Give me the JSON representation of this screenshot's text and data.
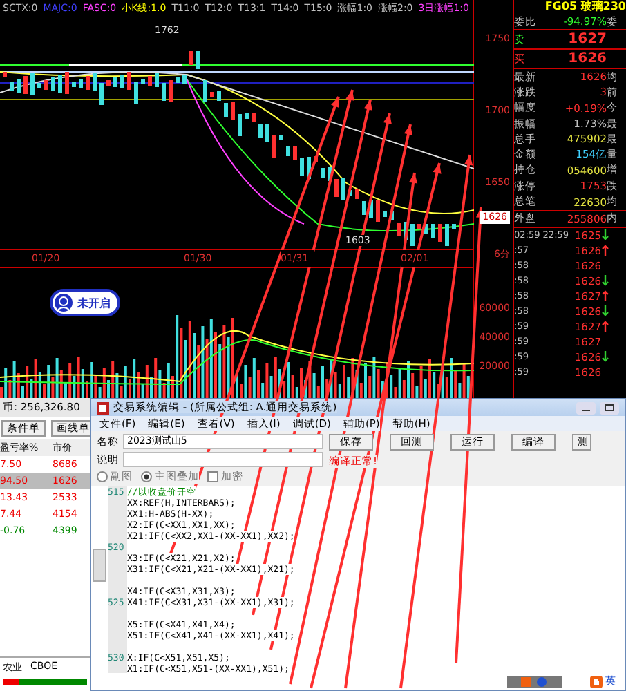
{
  "indicator_bar": [
    {
      "label": "SCTX:0",
      "color": "#c0c0c0"
    },
    {
      "label": "MAJC:0",
      "color": "#4040ff"
    },
    {
      "label": "FASC:0",
      "color": "#ff40ff"
    },
    {
      "label": "小K线:1.0",
      "color": "#ffff00"
    },
    {
      "label": "T11:0",
      "color": "#c0c0c0"
    },
    {
      "label": "T12:0",
      "color": "#c0c0c0"
    },
    {
      "label": "T13:1",
      "color": "#c0c0c0"
    },
    {
      "label": "T14:0",
      "color": "#c0c0c0"
    },
    {
      "label": "T15:0",
      "color": "#c0c0c0"
    },
    {
      "label": "涨幅1:0",
      "color": "#c0c0c0"
    },
    {
      "label": "涨幅2:0",
      "color": "#c0c0c0"
    },
    {
      "label": "3日涨幅1:0",
      "color": "#ff40ff"
    }
  ],
  "chart": {
    "peak_label": "1762",
    "low_label": "1603",
    "dates": [
      "01/20",
      "01/30",
      "01/31",
      "02/01"
    ],
    "price_axis": [
      "1750",
      "1700",
      "1650"
    ],
    "price_tag": "1626",
    "period": "6分",
    "volume_axis": [
      "60000",
      "40000",
      "20000"
    ]
  },
  "camera_widget": {
    "label": "未开启"
  },
  "quote": {
    "title": "FG05 玻璃230",
    "ratio": {
      "label": "委比",
      "value": "-94.97%",
      "extra": "委"
    },
    "book": [
      {
        "label": "卖",
        "price": "1627",
        "kind": "sell"
      },
      {
        "label": "买",
        "price": "1626",
        "kind": "buy"
      }
    ],
    "stats": [
      {
        "label": "最新",
        "value": "1626",
        "color": "#ff3030",
        "extra": "均"
      },
      {
        "label": "涨跌",
        "value": "3",
        "color": "#ff3030",
        "extra": "前"
      },
      {
        "label": "幅度",
        "value": "+0.19%",
        "color": "#ff3030",
        "extra": "今"
      },
      {
        "label": "振幅",
        "value": "1.73%",
        "color": "#c0c0c0",
        "extra": "最"
      },
      {
        "label": "总手",
        "value": "475902",
        "color": "#e0e040",
        "extra": "最"
      },
      {
        "label": "金额",
        "value": "154亿",
        "color": "#40d0ff",
        "extra": "量"
      },
      {
        "label": "持仓",
        "value": "054600",
        "color": "#e0e040",
        "extra": "增"
      },
      {
        "label": "涨停",
        "value": "1753",
        "color": "#ff3030",
        "extra": "跌"
      },
      {
        "label": "总笔",
        "value": "22630",
        "color": "#e0e040",
        "extra": "均"
      }
    ],
    "outer": {
      "label": "外盘",
      "value": "255806",
      "extra": "内"
    },
    "ticks": [
      {
        "time": "02:59 22:59",
        "price": "1625",
        "kind": "down"
      },
      {
        "time": ":57",
        "price": "1626",
        "kind": "up"
      },
      {
        "time": ":58",
        "price": "1626",
        "kind": "flat"
      },
      {
        "time": ":58",
        "price": "1626",
        "kind": "down"
      },
      {
        "time": ":58",
        "price": "1627",
        "kind": "up"
      },
      {
        "time": ":58",
        "price": "1626",
        "kind": "down"
      },
      {
        "time": ":59",
        "price": "1627",
        "kind": "up"
      },
      {
        "time": ":59",
        "price": "1627",
        "kind": "flat"
      },
      {
        "time": ":59",
        "price": "1626",
        "kind": "down"
      },
      {
        "time": ":59",
        "price": "1626",
        "kind": "flat"
      }
    ]
  },
  "account": {
    "balance": "币: 256,326.80",
    "buttons": [
      "条件单",
      "画线单"
    ],
    "columns": [
      "盈亏率%",
      "市价"
    ],
    "rows": [
      {
        "cells": [
          "7.50",
          "8686"
        ],
        "selected": false,
        "kind": "gain"
      },
      {
        "cells": [
          "94.50",
          "1626"
        ],
        "selected": true,
        "kind": "gain"
      },
      {
        "cells": [
          "13.43",
          "2533"
        ],
        "selected": false,
        "kind": "gain"
      },
      {
        "cells": [
          "7.44",
          "4154"
        ],
        "selected": false,
        "kind": "gain"
      },
      {
        "cells": [
          "-0.76",
          "4399"
        ],
        "selected": false,
        "kind": "loss"
      }
    ],
    "tabs": [
      "农业",
      "CBOE"
    ]
  },
  "editor": {
    "title": "交易系统编辑 - (所属公式组: A.通用交易系统)",
    "menu": [
      "文件(F)",
      "编辑(E)",
      "查看(V)",
      "插入(I)",
      "调试(D)",
      "辅助(P)",
      "帮助(H)"
    ],
    "name_label": "名称",
    "name_value": "2023测试山5",
    "desc_label": "说明",
    "options": [
      {
        "label": "副图",
        "kind": "radio",
        "selected": false
      },
      {
        "label": "主图叠加",
        "kind": "radio",
        "selected": true
      },
      {
        "label": "加密",
        "kind": "checkbox",
        "selected": false
      }
    ],
    "buttons": [
      "保存",
      "回测",
      "运行",
      "编译",
      "测"
    ],
    "status": "编译正常!",
    "lines": [
      {
        "num": "515",
        "text": "//以收盘价开空",
        "kind": "comment"
      },
      {
        "text": "XX:REF(H,INTERBARS);",
        "kind": "code"
      },
      {
        "text": "XX1:H-ABS(H-XX);",
        "kind": "code"
      },
      {
        "text": "X2:IF(C<XX1,XX1,XX);",
        "kind": "code"
      },
      {
        "text": "X21:IF(C<XX2,XX1-(XX-XX1),XX2);",
        "kind": "code"
      },
      {
        "num": "520",
        "kind": "blank"
      },
      {
        "text": "X3:IF(C<X21,X21,X2);",
        "kind": "code"
      },
      {
        "text": "X31:IF(C<X21,X21-(XX-XX1),X21);",
        "kind": "code"
      },
      {
        "kind": "blank"
      },
      {
        "text": "X4:IF(C<X31,X31,X3);",
        "kind": "code"
      },
      {
        "num": "525",
        "text": "X41:IF(C<X31,X31-(XX-XX1),X31);",
        "kind": "code"
      },
      {
        "kind": "blank"
      },
      {
        "text": "X5:IF(C<X41,X41,X4);",
        "kind": "code"
      },
      {
        "text": "X51:IF(C<X41,X41-(XX-XX1),X41);",
        "kind": "code"
      },
      {
        "kind": "blank"
      },
      {
        "num": "530",
        "text": "X:IF(C<X51,X51,X5);",
        "kind": "code"
      },
      {
        "text": "X1:IF(C<X51,X51-(XX-XX1),X51);",
        "kind": "code"
      }
    ]
  },
  "tray": {
    "ime": "英"
  }
}
